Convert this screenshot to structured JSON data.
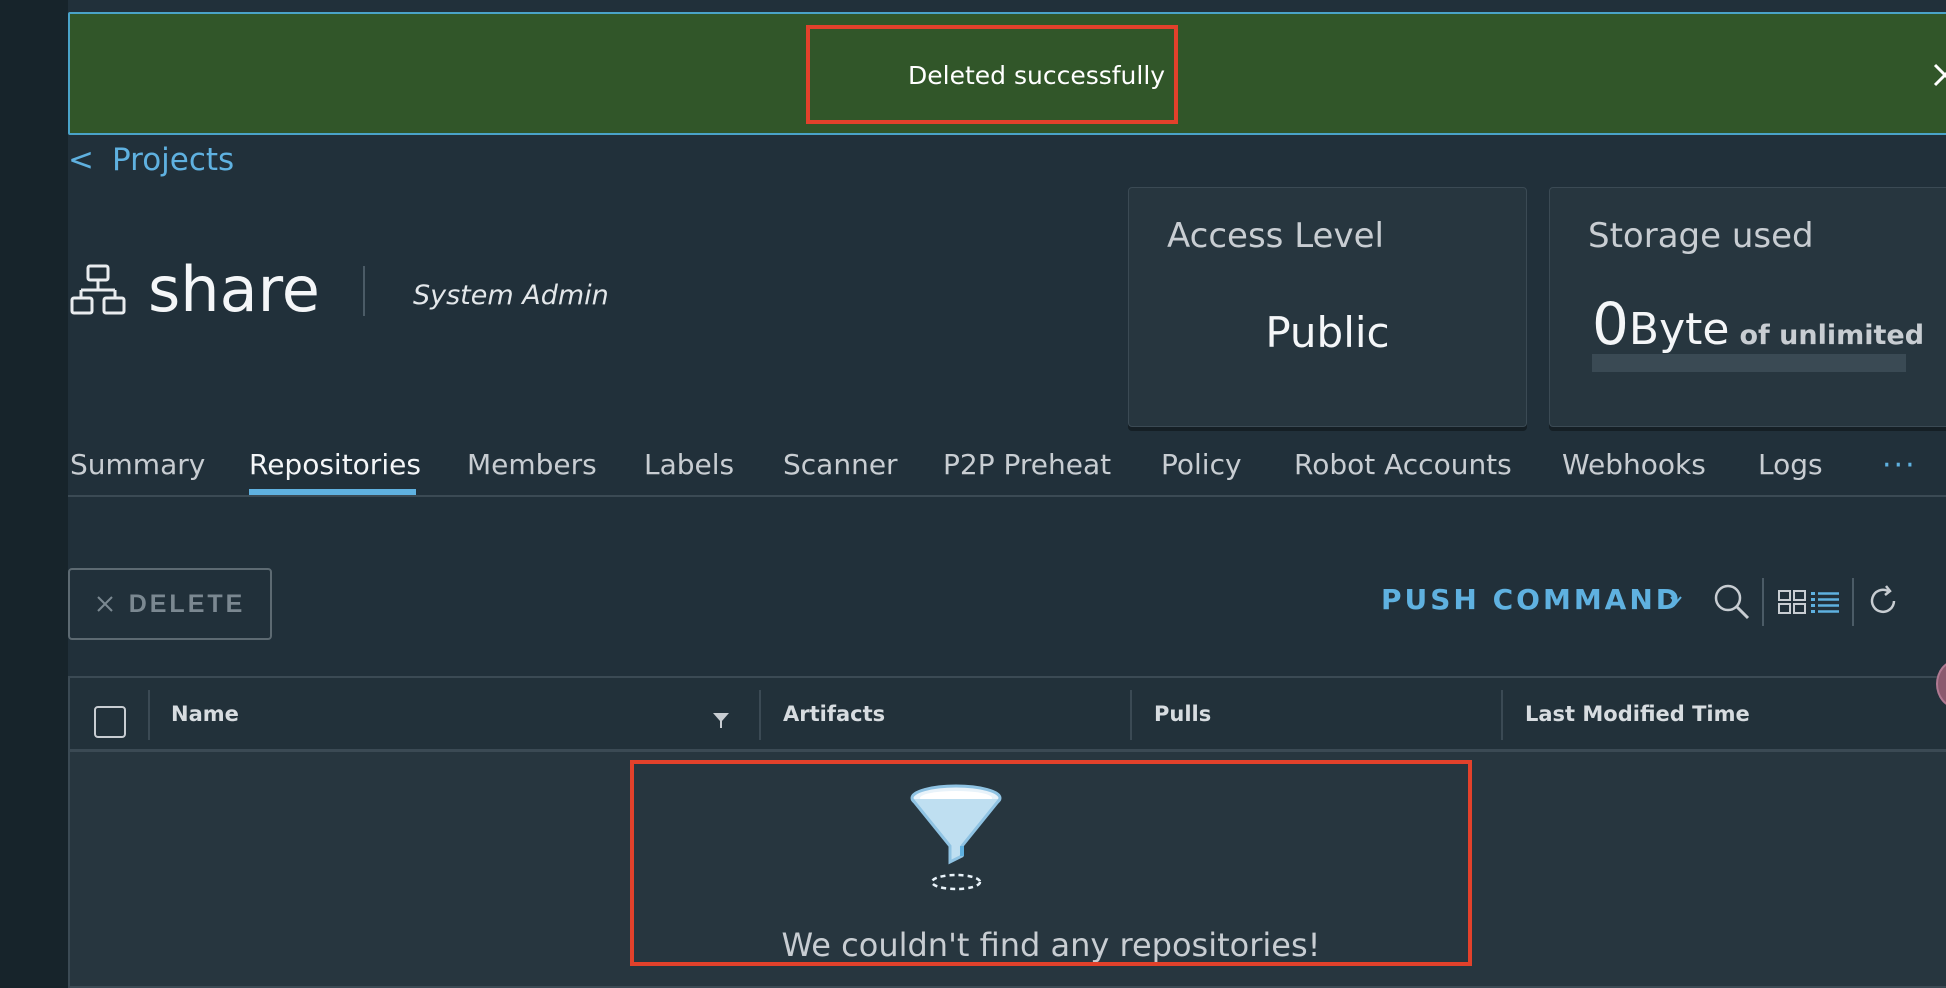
{
  "toast": {
    "message": "Deleted successfully",
    "close_icon": "close-icon"
  },
  "breadcrumb": {
    "chevron": "<",
    "label": "Projects"
  },
  "project": {
    "name": "share",
    "role": "System Admin",
    "icon": "project-hierarchy-icon"
  },
  "cards": {
    "access": {
      "title": "Access Level",
      "value": "Public"
    },
    "storage": {
      "title": "Storage used",
      "number": "0",
      "unit": "Byte",
      "of": "of unlimited",
      "used_fraction": 0
    }
  },
  "tabs": [
    {
      "label": "Summary"
    },
    {
      "label": "Repositories",
      "active": true
    },
    {
      "label": "Members"
    },
    {
      "label": "Labels"
    },
    {
      "label": "Scanner"
    },
    {
      "label": "P2P Preheat"
    },
    {
      "label": "Policy"
    },
    {
      "label": "Robot Accounts"
    },
    {
      "label": "Webhooks"
    },
    {
      "label": "Logs"
    }
  ],
  "tabs_more": "···",
  "toolbar": {
    "delete_label": "DELETE",
    "push_command_label": "PUSH COMMAND",
    "icons": [
      "search-icon",
      "card-view-icon",
      "list-view-icon",
      "refresh-icon"
    ]
  },
  "table": {
    "columns": [
      "Name",
      "Artifacts",
      "Pulls",
      "Last Modified Time"
    ],
    "rows": [],
    "empty_message": "We couldn't find any repositories!"
  },
  "colors": {
    "toast_bg": "#315629",
    "accent": "#5fb1e0",
    "highlight": "#e2412b",
    "page_bg": "#21303a"
  }
}
